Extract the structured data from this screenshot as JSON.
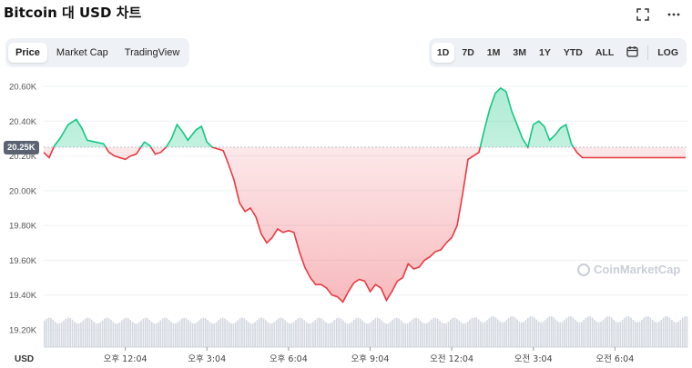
{
  "title": "Bitcoin 대 USD 차트",
  "tabs": [
    {
      "label": "Price",
      "active": true
    },
    {
      "label": "Market Cap",
      "active": false
    },
    {
      "label": "TradingView",
      "active": false
    }
  ],
  "ranges": [
    {
      "label": "1D",
      "active": true
    },
    {
      "label": "7D",
      "active": false
    },
    {
      "label": "1M",
      "active": false
    },
    {
      "label": "3M",
      "active": false
    },
    {
      "label": "1Y",
      "active": false
    },
    {
      "label": "YTD",
      "active": false
    },
    {
      "label": "ALL",
      "active": false
    }
  ],
  "log_label": "LOG",
  "icons": {
    "fullscreen": "fullscreen-icon",
    "more": "more-icon",
    "calendar": "calendar-icon"
  },
  "current_price_label": "20.25K",
  "watermark": "CoinMarketCap",
  "colors": {
    "up": "#16c784",
    "down": "#ea3943",
    "volume": "#d3d8e0"
  },
  "chart_data": {
    "type": "area",
    "currency_label": "USD",
    "y_ticks": [
      "20.60K",
      "20.40K",
      "20.20K",
      "20.00K",
      "19.80K",
      "19.60K",
      "19.40K",
      "19.20K"
    ],
    "y_tick_values": [
      20600,
      20400,
      20200,
      20000,
      19800,
      19600,
      19400,
      19200
    ],
    "ylim": [
      19100,
      20700
    ],
    "baseline": 20250,
    "x_ticks": [
      "오후 12:04",
      "오후 3:04",
      "오후 6:04",
      "오후 9:04",
      "오전 12:04",
      "오전 3:04",
      "오전 6:04"
    ],
    "x_tick_positions": [
      3,
      6,
      9,
      12,
      15,
      18,
      21
    ],
    "xlim": [
      0,
      23.7
    ],
    "x": [
      0.0,
      0.2,
      0.4,
      0.6,
      0.9,
      1.2,
      1.4,
      1.6,
      1.9,
      2.2,
      2.4,
      2.6,
      2.8,
      3.0,
      3.2,
      3.4,
      3.7,
      3.9,
      4.1,
      4.3,
      4.5,
      4.7,
      4.9,
      5.1,
      5.3,
      5.6,
      5.8,
      6.0,
      6.2,
      6.4,
      6.6,
      6.8,
      7.0,
      7.2,
      7.4,
      7.6,
      7.8,
      8.0,
      8.2,
      8.4,
      8.6,
      8.8,
      9.0,
      9.2,
      9.4,
      9.6,
      9.8,
      10.0,
      10.2,
      10.4,
      10.6,
      10.8,
      11.0,
      11.2,
      11.4,
      11.6,
      11.8,
      12.0,
      12.2,
      12.4,
      12.6,
      12.8,
      13.0,
      13.2,
      13.4,
      13.6,
      13.8,
      14.0,
      14.2,
      14.4,
      14.6,
      14.8,
      15.0,
      15.2,
      15.4,
      15.6,
      15.8,
      16.0,
      16.2,
      16.4,
      16.6,
      16.8,
      17.0,
      17.2,
      17.4,
      17.6,
      17.8,
      18.0,
      18.2,
      18.4,
      18.6,
      18.8,
      19.0,
      19.2,
      19.4,
      19.6,
      19.8,
      20.0,
      20.2,
      20.4,
      20.6,
      20.8,
      21.0,
      21.2,
      21.4,
      21.6,
      21.8,
      22.0,
      22.2,
      22.4,
      22.6,
      22.8,
      23.0,
      23.2,
      23.4,
      23.6
    ],
    "y": [
      20220,
      20190,
      20260,
      20300,
      20380,
      20410,
      20360,
      20290,
      20280,
      20270,
      20220,
      20200,
      20190,
      20180,
      20200,
      20210,
      20280,
      20260,
      20210,
      20220,
      20250,
      20300,
      20380,
      20340,
      20290,
      20350,
      20370,
      20280,
      20250,
      20240,
      20230,
      20150,
      20060,
      19930,
      19880,
      19900,
      19850,
      19750,
      19700,
      19730,
      19780,
      19760,
      19770,
      19760,
      19650,
      19560,
      19500,
      19460,
      19460,
      19440,
      19400,
      19390,
      19360,
      19420,
      19470,
      19490,
      19480,
      19420,
      19460,
      19440,
      19370,
      19420,
      19480,
      19500,
      19580,
      19550,
      19560,
      19600,
      19620,
      19650,
      19660,
      19700,
      19730,
      19800,
      19980,
      20180,
      20200,
      20220,
      20350,
      20470,
      20560,
      20590,
      20570,
      20460,
      20380,
      20300,
      20250,
      20380,
      20400,
      20370,
      20290,
      20320,
      20360,
      20380,
      20270,
      20220,
      20190,
      20190,
      20190,
      20190,
      20190,
      20190,
      20190,
      20190,
      20190,
      20190,
      20190,
      20190,
      20190,
      20190,
      20190,
      20190,
      20190,
      20190,
      20190,
      20190
    ],
    "volume_level": 0.9,
    "grid": true,
    "legend": "none"
  }
}
